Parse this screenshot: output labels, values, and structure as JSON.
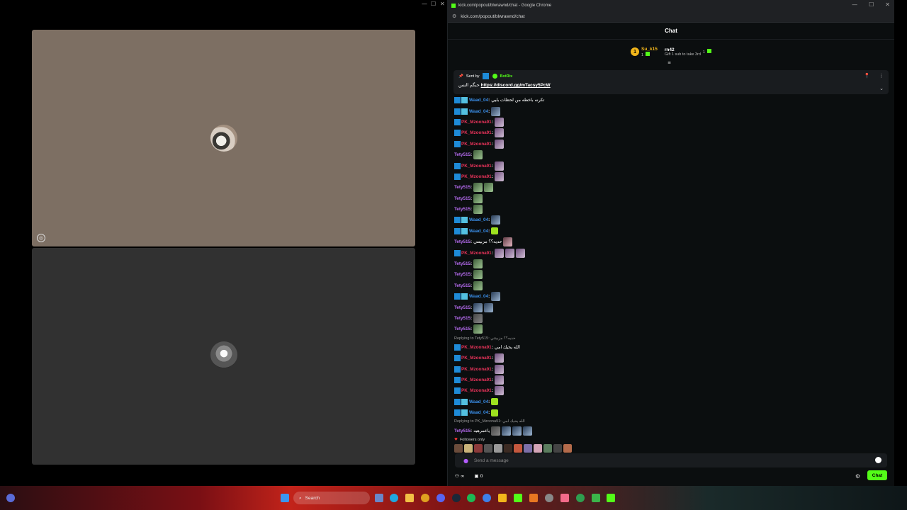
{
  "call": {
    "window_controls": [
      "—",
      "☐",
      "✕"
    ],
    "tile_a": {
      "avatar": "user-avatar",
      "camera_icon": "camera-off-icon"
    },
    "tile_b": {
      "avatar": "user-avatar"
    }
  },
  "chrome": {
    "title": "kick.com/popout/blwrawnd/chat - Google Chrome",
    "url": "kick.com/popout/blwrawnd/chat",
    "controls": [
      "—",
      "☐",
      "✕"
    ]
  },
  "chat": {
    "header": "Chat",
    "leaderboard": [
      {
        "rank": "1",
        "name": "Su_k15",
        "count": "1"
      },
      {
        "name": "rn42",
        "sub": "Gift 1 sub to take 3rd",
        "count": "1"
      }
    ],
    "pinned": {
      "sent_by": "Sent by",
      "bot": "BotRix",
      "text": "حبگم النس",
      "link": "https://discord.gg/mTacsy5PcW"
    },
    "messages": [
      {
        "user": "Waad_04",
        "color": "#3a8ee8",
        "badges": 2,
        "text": "تكرنه باخطه من لحظات بليي"
      },
      {
        "user": "Waad_04",
        "color": "#3a8ee8",
        "badges": 2,
        "emotes": [
          "blue"
        ]
      },
      {
        "user": "PK_Mzoona91",
        "color": "#e8335a",
        "badges": 1,
        "emotes": [
          "purple"
        ]
      },
      {
        "user": "PK_Mzoona91",
        "color": "#e8335a",
        "badges": 1,
        "emotes": [
          "purple"
        ]
      },
      {
        "user": "PK_Mzoona91",
        "color": "#e8335a",
        "badges": 1,
        "emotes": [
          "purple"
        ]
      },
      {
        "user": "Tety515",
        "color": "#b76cf2",
        "badges": 0,
        "emotes": [
          "green"
        ]
      },
      {
        "user": "PK_Mzoona91",
        "color": "#e8335a",
        "badges": 1,
        "emotes": [
          "purple"
        ]
      },
      {
        "user": "PK_Mzoona91",
        "color": "#e8335a",
        "badges": 1,
        "emotes": [
          "purple"
        ]
      },
      {
        "user": "Tety515",
        "color": "#b76cf2",
        "badges": 0,
        "emotes": [
          "green",
          "green"
        ]
      },
      {
        "user": "Tety515",
        "color": "#b76cf2",
        "badges": 0,
        "emotes": [
          "green"
        ]
      },
      {
        "user": "Tety515",
        "color": "#b76cf2",
        "badges": 0,
        "emotes": [
          "green"
        ]
      },
      {
        "user": "Waad_04",
        "color": "#3a8ee8",
        "badges": 2,
        "emotes": [
          "blue"
        ]
      },
      {
        "user": "Waad_04",
        "color": "#3a8ee8",
        "badges": 2,
        "emotes": [
          "lime"
        ]
      },
      {
        "user": "Tety515",
        "color": "#b76cf2",
        "badges": 0,
        "text": "حديه؟؟ مزبيتتي",
        "emotes": [
          "pink"
        ]
      },
      {
        "user": "PK_Mzoona91",
        "color": "#e8335a",
        "badges": 1,
        "emotes": [
          "purple",
          "purple",
          "purple"
        ]
      },
      {
        "user": "Tety515",
        "color": "#b76cf2",
        "badges": 0,
        "emotes": [
          "green"
        ]
      },
      {
        "user": "Tety515",
        "color": "#b76cf2",
        "badges": 0,
        "emotes": [
          "green"
        ]
      },
      {
        "user": "Tety515",
        "color": "#b76cf2",
        "badges": 0,
        "emotes": [
          "green"
        ]
      },
      {
        "user": "Waad_04",
        "color": "#3a8ee8",
        "badges": 2,
        "emotes": [
          "blue"
        ]
      },
      {
        "user": "Tety515",
        "color": "#b76cf2",
        "badges": 0,
        "emotes": [
          "blue",
          "blue"
        ]
      },
      {
        "user": "Tety515",
        "color": "#b76cf2",
        "badges": 0,
        "emotes": [
          "grey"
        ]
      },
      {
        "user": "Tety515",
        "color": "#b76cf2",
        "badges": 0,
        "emotes": [
          "green"
        ]
      },
      {
        "reply": "Replying to Tety515: حديه؟؟ مزبيتتي"
      },
      {
        "user": "PK_Mzoona91",
        "color": "#e8335a",
        "badges": 1,
        "text": "الله يحيك امي"
      },
      {
        "user": "PK_Mzoona91",
        "color": "#e8335a",
        "badges": 1,
        "emotes": [
          "purple"
        ]
      },
      {
        "user": "PK_Mzoona91",
        "color": "#e8335a",
        "badges": 1,
        "emotes": [
          "purple"
        ]
      },
      {
        "user": "PK_Mzoona91",
        "color": "#e8335a",
        "badges": 1,
        "emotes": [
          "purple"
        ]
      },
      {
        "user": "PK_Mzoona91",
        "color": "#e8335a",
        "badges": 1,
        "emotes": [
          "purple"
        ]
      },
      {
        "user": "Waad_04",
        "color": "#3a8ee8",
        "badges": 2,
        "emotes": [
          "lime"
        ]
      },
      {
        "user": "Waad_04",
        "color": "#3a8ee8",
        "badges": 2,
        "emotes": [
          "lime"
        ]
      },
      {
        "reply": "Replying to PK_Mzoona91: الله يحيك امي"
      },
      {
        "user": "Tety515",
        "color": "#b76cf2",
        "badges": 0,
        "text": "ياعمرهيه",
        "emotes": [
          "grey",
          "blue",
          "blue",
          "blue"
        ]
      }
    ],
    "followers_only": "Followers only",
    "input_placeholder": "Send a message",
    "bottom": {
      "points": "∞",
      "gift": "0",
      "chat_button": "Chat"
    }
  },
  "taskbar": {
    "search_placeholder": "Search",
    "icons": [
      "windows-start-icon",
      "search-icon",
      "task-view-icon",
      "edge-icon",
      "file-explorer-icon",
      "chrome-icon",
      "discord-icon",
      "steam-icon",
      "spotify-icon",
      "teams-icon",
      "app-icon"
    ]
  }
}
